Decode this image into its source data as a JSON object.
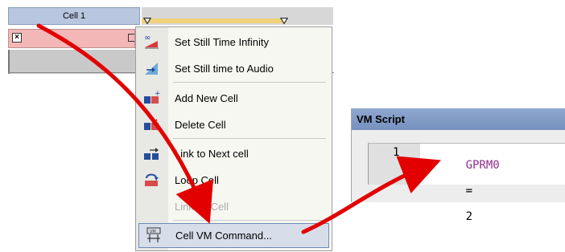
{
  "timeline": {
    "cell_label": "Cell 1"
  },
  "menu": {
    "items": [
      {
        "label": "Set Still Time Infinity",
        "icon": "still-time-infinity-icon",
        "disabled": false,
        "selected": false
      },
      {
        "label": "Set Still time to Audio",
        "icon": "still-time-audio-icon",
        "disabled": false,
        "selected": false
      },
      {
        "label": "Add New Cell",
        "icon": "add-cell-icon",
        "disabled": false,
        "selected": false
      },
      {
        "label": "Delete Cell",
        "icon": "delete-cell-icon",
        "disabled": false,
        "selected": false
      },
      {
        "label": "Link to Next cell",
        "icon": "link-next-cell-icon",
        "disabled": false,
        "selected": false
      },
      {
        "label": "Loop Cell",
        "icon": "loop-cell-icon",
        "disabled": false,
        "selected": false
      },
      {
        "label": "Link To Cell",
        "icon": "link-to-cell-icon",
        "disabled": true,
        "selected": false
      },
      {
        "label": "Cell VM Command...",
        "icon": "vm-command-icon",
        "disabled": false,
        "selected": true
      }
    ]
  },
  "vm_script": {
    "title": "VM Script",
    "line_number": "1",
    "code": {
      "variable": "GPRM0",
      "operator": "=",
      "value": "2"
    }
  },
  "colors": {
    "cell_header": "#b8c6e0",
    "pink_row": "#f4b7b7",
    "gold_track": "#efd27a",
    "menu_selected": "#d7deea",
    "vm_title": "#7f98c4",
    "arrow": "#e20000",
    "variable_text": "#8f2a8f"
  }
}
